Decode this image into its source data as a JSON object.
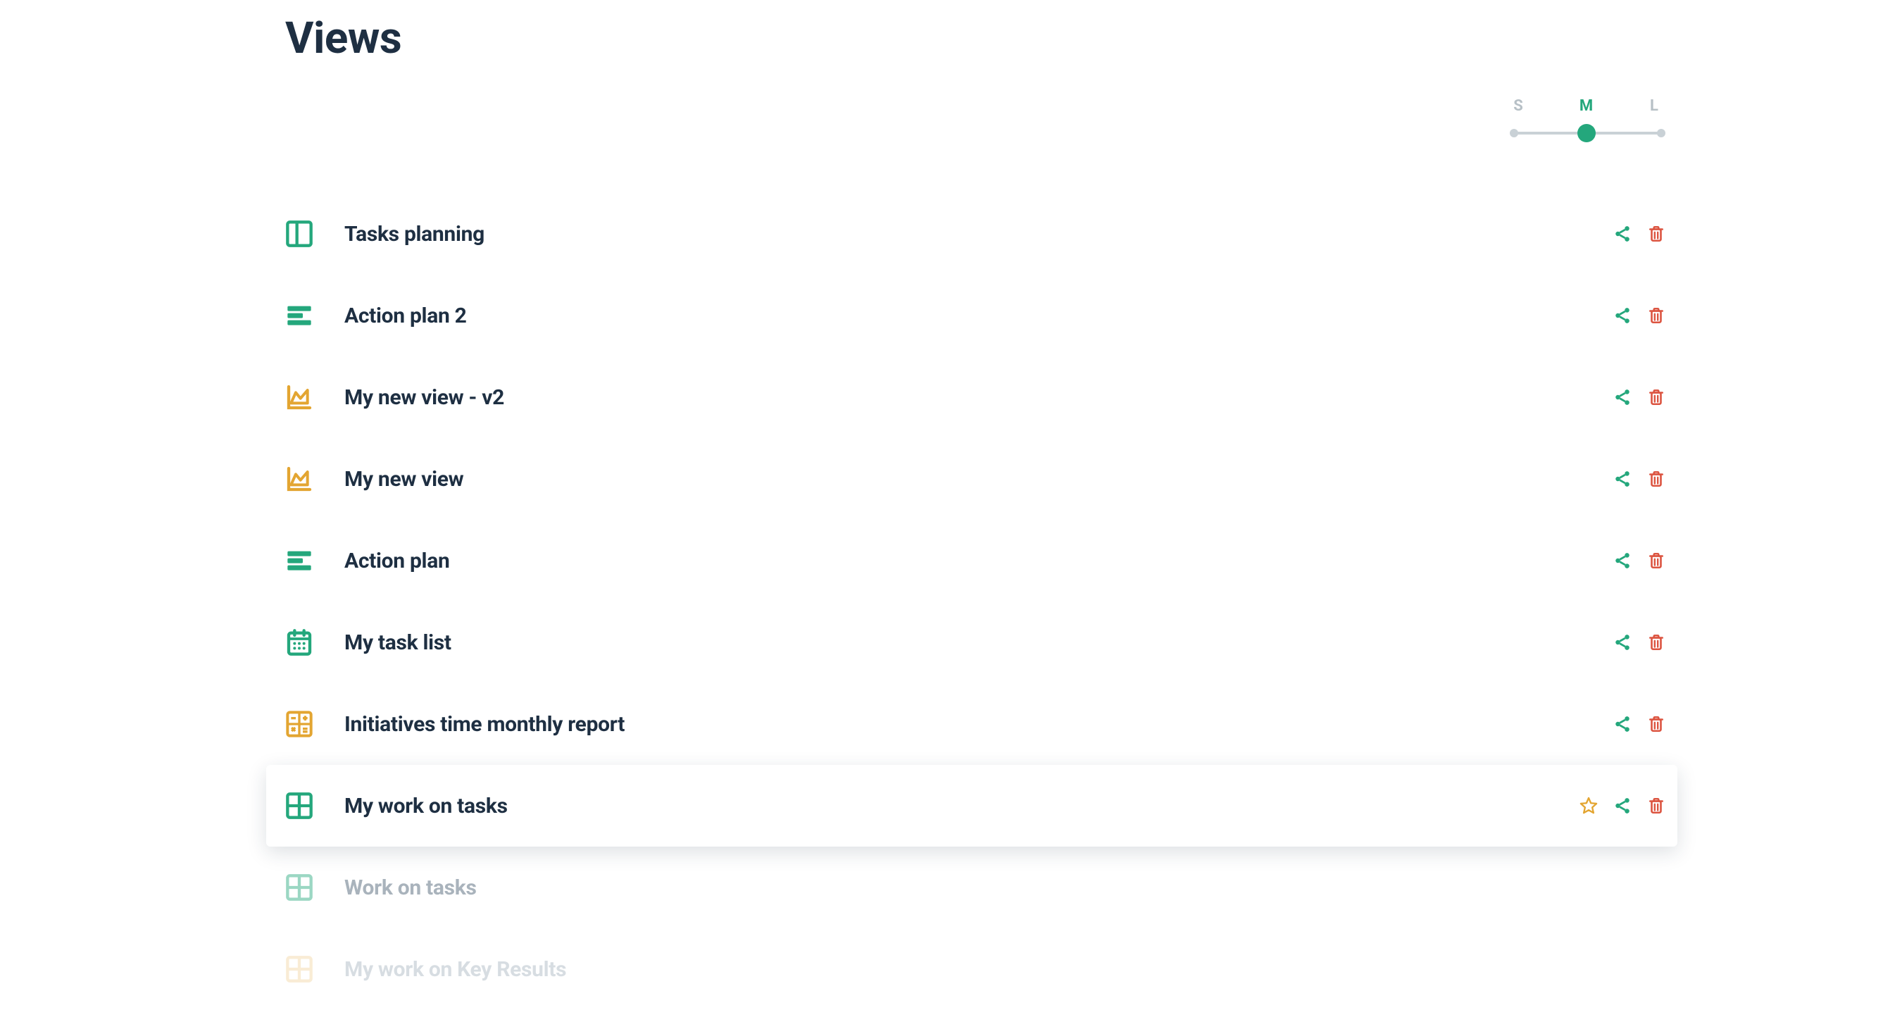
{
  "page": {
    "title": "Views"
  },
  "size_slider": {
    "s": "S",
    "m": "M",
    "l": "L",
    "active": "M"
  },
  "colors": {
    "green": "#24a77c",
    "amber": "#e3a531",
    "red": "#dc5440",
    "text": "#1e2f42"
  },
  "views": [
    {
      "label": "Tasks planning",
      "icon": "columns",
      "icon_color": "green",
      "show_star": false,
      "state": "normal"
    },
    {
      "label": "Action plan 2",
      "icon": "rows",
      "icon_color": "green",
      "show_star": false,
      "state": "normal"
    },
    {
      "label": "My new view - v2",
      "icon": "area",
      "icon_color": "amber",
      "show_star": false,
      "state": "normal"
    },
    {
      "label": "My new view",
      "icon": "area",
      "icon_color": "amber",
      "show_star": false,
      "state": "normal"
    },
    {
      "label": "Action plan",
      "icon": "rows",
      "icon_color": "green",
      "show_star": false,
      "state": "normal"
    },
    {
      "label": "My task list",
      "icon": "calendar",
      "icon_color": "green",
      "show_star": false,
      "state": "normal"
    },
    {
      "label": "Initiatives time monthly report",
      "icon": "calc",
      "icon_color": "amber",
      "show_star": false,
      "state": "normal"
    },
    {
      "label": "My work on tasks",
      "icon": "grid",
      "icon_color": "green",
      "show_star": true,
      "state": "hovered"
    },
    {
      "label": "Work on tasks",
      "icon": "grid",
      "icon_color": "green",
      "show_star": false,
      "state": "dim"
    },
    {
      "label": "My work on Key Results",
      "icon": "grid",
      "icon_color": "amber",
      "show_star": false,
      "state": "dimmer"
    }
  ]
}
